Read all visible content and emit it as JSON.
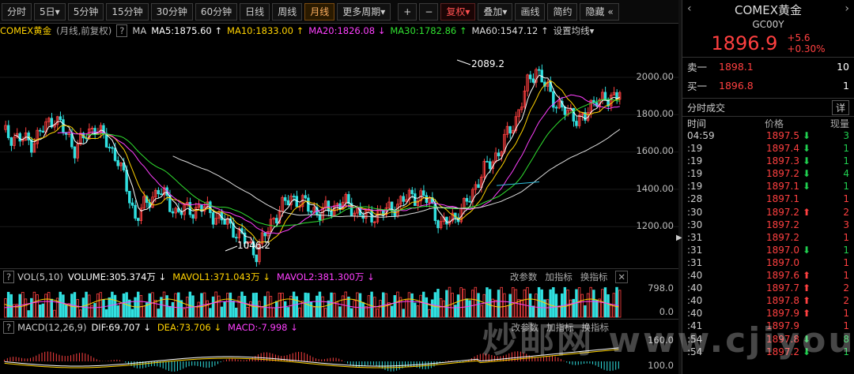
{
  "toolbar": {
    "periods": [
      "分时",
      "5日▾",
      "5分钟",
      "15分钟",
      "30分钟",
      "60分钟",
      "日线",
      "周线",
      "月线",
      "更多周期▾"
    ],
    "active_index": 8,
    "plus": "+",
    "minus": "−",
    "adjust": "复权▾",
    "overlay": "叠加▾",
    "draw": "画线",
    "simple": "简约",
    "hide": "隐藏",
    "more": "«"
  },
  "ma_line": {
    "name": "COMEX黄金",
    "mode": "(月线,前复权)",
    "help": "?",
    "ma": "MA",
    "ma5": "MA5:1875.60 ↑",
    "ma10": "MA10:1833.00 ↑",
    "ma20": "MA20:1826.08 ↓",
    "ma30": "MA30:1782.86 ↑",
    "ma60": "MA60:1547.12 ↑",
    "settings": "设置均线▾"
  },
  "colors": {
    "ma5": "#ffffff",
    "ma10": "#ffd200",
    "ma20": "#ff40ff",
    "ma30": "#30e030",
    "ma60": "#dddddd",
    "up": "#ff4040",
    "down": "#30e0e0"
  },
  "main_axis": [
    "2000.00",
    "1800.00",
    "1600.00",
    "1400.00",
    "1200.00"
  ],
  "annotations": {
    "high": "2089.2",
    "low": "1046.2"
  },
  "vol_bar": {
    "help": "?",
    "name": "VOL(5,10)",
    "volume": "VOLUME:305.374万 ↓",
    "mavol1": "MAVOL1:371.043万 ↓",
    "mavol2": "MAVOL2:381.300万 ↓",
    "edit": "改参数",
    "add": "加指标",
    "replace": "换指标",
    "close": "✕"
  },
  "vol_axis": [
    "798.0",
    "0.0"
  ],
  "macd_bar": {
    "help": "?",
    "name": "MACD(12,26,9)",
    "dif": "DIF:69.707 ↓",
    "dea": "DEA:73.706 ↓",
    "macd": "MACD:-7.998 ↓",
    "edit": "改参数",
    "add": "加指标",
    "replace": "换指标"
  },
  "macd_axis": [
    "160.0",
    "100.0"
  ],
  "watermark": "炒邮网 www.cjiyou.net",
  "quote": {
    "title": "COMEX黄金",
    "code": "GC00Y",
    "price": "1896.9",
    "change": "+5.6",
    "change_pct": "+0.30%",
    "sell_label": "卖一",
    "sell_price": "1898.1",
    "sell_vol": "10",
    "buy_label": "买一",
    "buy_price": "1896.8",
    "buy_vol": "1",
    "ticks_title": "分时成交",
    "detail": "详",
    "col_time": "时间",
    "col_price": "价格",
    "col_vol": "现量"
  },
  "ticks": [
    {
      "t": "04:59",
      "p": "1897.5",
      "d": "down",
      "v": "3"
    },
    {
      "t": ":19",
      "p": "1897.4",
      "d": "down",
      "v": "1"
    },
    {
      "t": ":19",
      "p": "1897.3",
      "d": "down",
      "v": "1"
    },
    {
      "t": ":19",
      "p": "1897.2",
      "d": "down",
      "v": "4"
    },
    {
      "t": ":19",
      "p": "1897.1",
      "d": "down",
      "v": "1"
    },
    {
      "t": ":28",
      "p": "1897.1",
      "d": "",
      "v": "1"
    },
    {
      "t": ":30",
      "p": "1897.2",
      "d": "up",
      "v": "2"
    },
    {
      "t": ":30",
      "p": "1897.2",
      "d": "",
      "v": "3"
    },
    {
      "t": ":31",
      "p": "1897.2",
      "d": "",
      "v": "1"
    },
    {
      "t": ":31",
      "p": "1897.0",
      "d": "down",
      "v": "1"
    },
    {
      "t": ":31",
      "p": "1897.0",
      "d": "",
      "v": "1"
    },
    {
      "t": ":40",
      "p": "1897.6",
      "d": "up",
      "v": "1"
    },
    {
      "t": ":40",
      "p": "1897.7",
      "d": "up",
      "v": "2"
    },
    {
      "t": ":40",
      "p": "1897.8",
      "d": "up",
      "v": "2"
    },
    {
      "t": ":40",
      "p": "1897.9",
      "d": "up",
      "v": "1"
    },
    {
      "t": ":41",
      "p": "1897.9",
      "d": "",
      "v": "1"
    },
    {
      "t": ":54",
      "p": "1897.8",
      "d": "down",
      "v": "8"
    },
    {
      "t": ":54",
      "p": "1897.2",
      "d": "down",
      "v": "1"
    }
  ]
}
